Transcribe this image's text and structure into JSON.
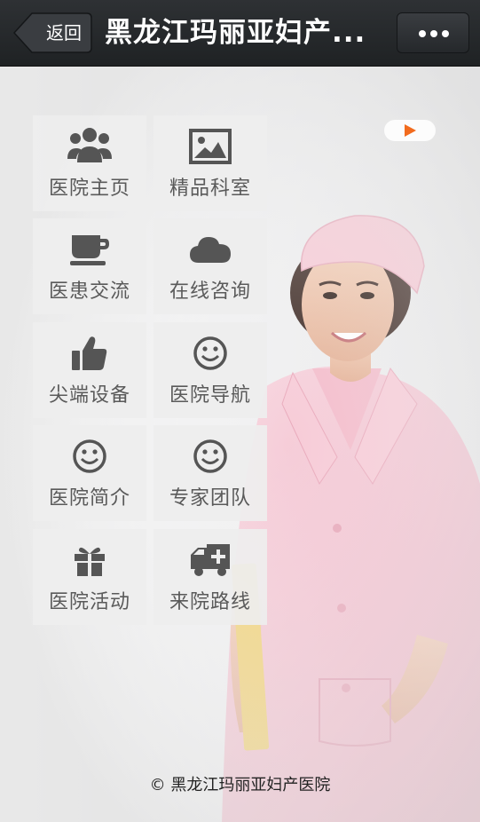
{
  "header": {
    "back_label": "返回",
    "title": "黑龙江玛丽亚妇产...",
    "more_icon": "more-icon"
  },
  "menu": [
    {
      "label": "医院主页",
      "icon": "users-icon"
    },
    {
      "label": "精品科室",
      "icon": "image-icon"
    },
    {
      "label": "医患交流",
      "icon": "coffee-cup-icon"
    },
    {
      "label": "在线咨询",
      "icon": "cloud-icon"
    },
    {
      "label": "尖端设备",
      "icon": "thumbs-up-icon"
    },
    {
      "label": "医院导航",
      "icon": "smiley-icon"
    },
    {
      "label": "医院简介",
      "icon": "smiley-icon"
    },
    {
      "label": "专家团队",
      "icon": "smiley-icon"
    },
    {
      "label": "医院活动",
      "icon": "gift-icon"
    },
    {
      "label": "来院路线",
      "icon": "ambulance-icon"
    }
  ],
  "footer": {
    "text": "© 黑龙江玛丽亚妇产医院"
  },
  "colors": {
    "navbar": "#2b2e31",
    "tile_bg": "#eeeeee",
    "icon": "#555555",
    "play_accent": "#f26b1d",
    "uniform": "#f4c6d3"
  }
}
